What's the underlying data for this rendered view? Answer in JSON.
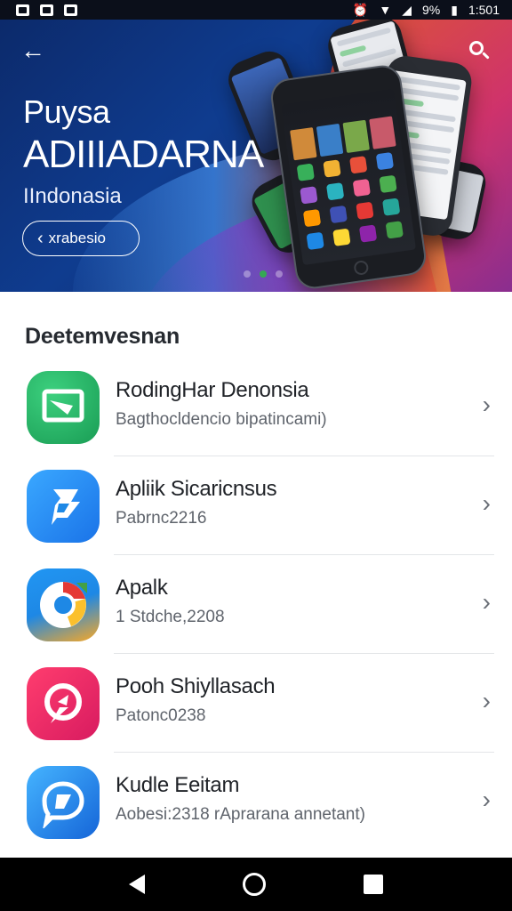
{
  "status_bar": {
    "battery": "9%",
    "time": "1:501"
  },
  "hero": {
    "line1": "Puysa",
    "line2": "ADIIIADARNA",
    "line3": "IIndonasia",
    "pill_label": "xrabesio",
    "pill_icon": "chevron-left-icon",
    "back_icon": "arrow-left-icon",
    "search_icon": "search-icon",
    "carousel": {
      "pages": 3,
      "active": 2
    }
  },
  "section": {
    "title": "Deetemvesnan"
  },
  "apps": [
    {
      "title": "RodingHar Denonsia",
      "subtitle": "Bagthocldencio bipatincami)",
      "icon": "cast-icon",
      "color": "#22b566"
    },
    {
      "title": "Apliik Sicaricnsus",
      "subtitle": "Pabrnc2216",
      "icon": "flag-icon",
      "color": "#2196f3"
    },
    {
      "title": "Apalk",
      "subtitle": "1 Stdche,2208",
      "icon": "chrome-icon",
      "color": "#1e88e5"
    },
    {
      "title": "Pooh Shiyllasach",
      "subtitle": "Patonc0238",
      "icon": "pin-icon",
      "color": "#e91e63"
    },
    {
      "title": "Kudle Eeitam",
      "subtitle": "Aobesi:2318 rAprarana annetant)",
      "icon": "chat-icon",
      "color": "#1e6fe0"
    }
  ],
  "nav": {
    "back_icon": "nav-back-icon",
    "home_icon": "nav-home-icon",
    "recent_icon": "nav-recents-icon"
  }
}
